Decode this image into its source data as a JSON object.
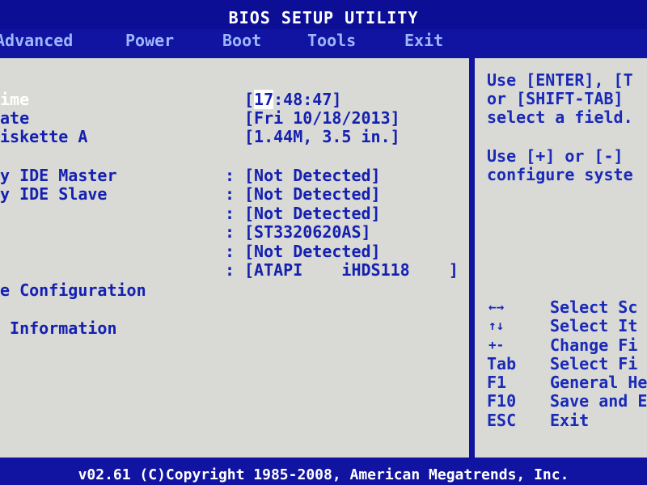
{
  "title": "BIOS SETUP UTILITY",
  "menu": [
    {
      "label": "Advanced"
    },
    {
      "label": "Power"
    },
    {
      "label": "Boot"
    },
    {
      "label": "Tools"
    },
    {
      "label": "Exit"
    }
  ],
  "main": {
    "rows": [
      {
        "label": "ime",
        "value_prefix": "[",
        "value_highlight": "17",
        "value_rest": ":48:47]"
      },
      {
        "label": "ate",
        "value": "[Fri 10/18/2013]"
      },
      {
        "label": "iskette A",
        "value": "[1.44M, 3.5 in.]"
      },
      {
        "label": "y IDE Master",
        "sep": ":",
        "value": "[Not Detected]"
      },
      {
        "label": "y IDE Slave",
        "sep": ":",
        "value": "[Not Detected]"
      },
      {
        "label": "",
        "sep": ":",
        "value": "[Not Detected]"
      },
      {
        "label": "",
        "sep": ":",
        "value": "[ST3320620AS]"
      },
      {
        "label": "",
        "sep": ":",
        "value": "[Not Detected]"
      },
      {
        "label": "",
        "sep": ":",
        "value": "[ATAPI    iHDS118    ]"
      },
      {
        "label": "e Configuration"
      },
      {
        "label": " Information"
      }
    ]
  },
  "help": {
    "lines": [
      "Use [ENTER], [T",
      "or [SHIFT-TAB]",
      "select a field.",
      "Use [+] or [-]",
      "configure syste"
    ]
  },
  "keys": [
    {
      "key": "←→",
      "icon": "left-right-arrows-icon",
      "desc": "Select Sc"
    },
    {
      "key": "↑↓",
      "icon": "up-down-arrows-icon",
      "desc": "Select It"
    },
    {
      "key": "+-",
      "icon": "plus-minus-icon",
      "desc": "Change Fi"
    },
    {
      "key": "Tab",
      "desc": "Select Fi"
    },
    {
      "key": "F1",
      "desc": "General He"
    },
    {
      "key": "F10",
      "desc": "Save and E"
    },
    {
      "key": "ESC",
      "desc": "Exit"
    }
  ],
  "footer": "v02.61 (C)Copyright 1985-2008, American Megatrends, Inc.",
  "colors": {
    "background": "#1014a0",
    "panel": "#d9d9d6",
    "text_blue": "#1420b0",
    "menu_inactive": "#9fb6ff",
    "highlight": "#ffffff"
  }
}
